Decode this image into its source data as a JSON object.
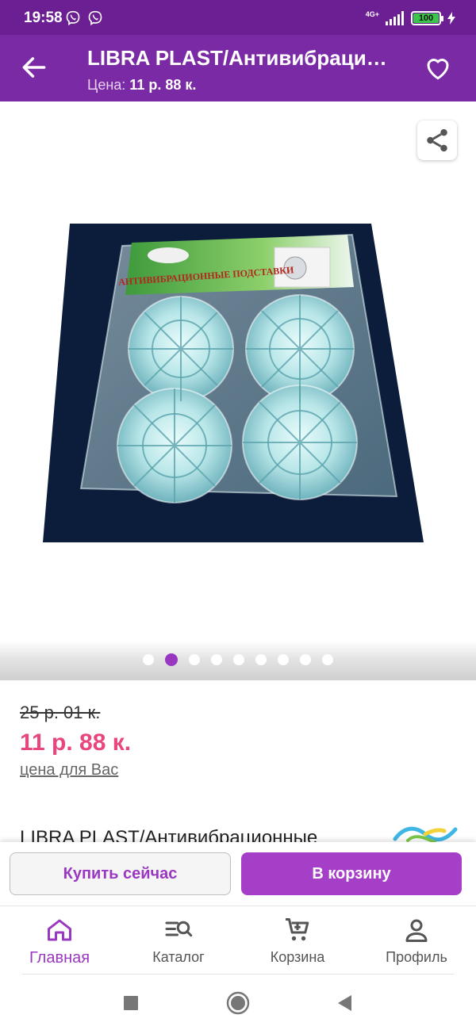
{
  "status_bar": {
    "time": "19:58",
    "network": "4G+",
    "battery": "100"
  },
  "header": {
    "title": "LIBRA PLAST/Антивибрационные подставки",
    "price_label": "Цена:",
    "price_value": "11 р. 88 к."
  },
  "gallery": {
    "packaging_text": "АНТИВИБРАЦИОННЫЕ ПОДСТАВКИ",
    "dots_count": 9,
    "active_dot": 2
  },
  "product": {
    "old_price": "25 р. 01 к.",
    "new_price": "11 р. 88 к.",
    "price_note": "цена для Вас",
    "description": "LIBRA PLAST/Антивибрационные"
  },
  "actions": {
    "buy_now": "Купить сейчас",
    "add_to_cart": "В корзину"
  },
  "bottom_nav": [
    {
      "label": "Главная",
      "icon": "home-icon",
      "active": true
    },
    {
      "label": "Каталог",
      "icon": "catalog-search-icon",
      "active": false
    },
    {
      "label": "Корзина",
      "icon": "cart-icon",
      "active": false
    },
    {
      "label": "Профиль",
      "icon": "profile-icon",
      "active": false
    }
  ],
  "colors": {
    "status_bar": "#6b1f92",
    "header": "#7b2aa5",
    "accent": "#a63fc7",
    "price": "#e8467c"
  }
}
